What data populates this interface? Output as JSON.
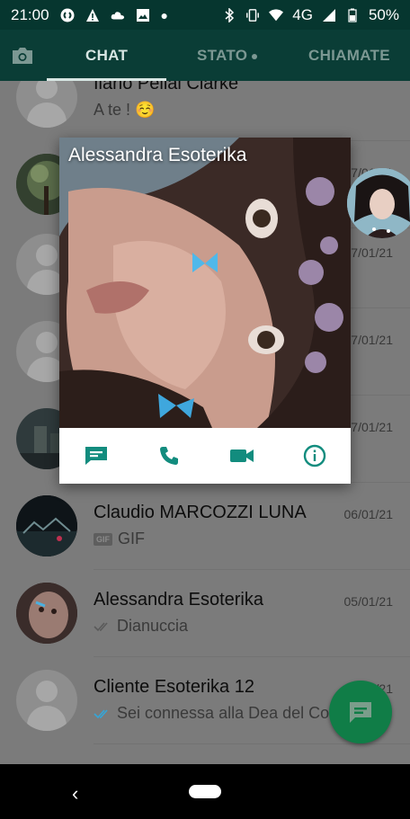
{
  "status_bar": {
    "time": "21:00",
    "network": "4G",
    "battery": "50%"
  },
  "tabs": {
    "chat": "CHAT",
    "stato": "STATO",
    "chiamate": "CHIAMATE"
  },
  "chats": [
    {
      "name": "Ilario Pellai Clarke",
      "message": "A te ! ☺️",
      "date": ""
    },
    {
      "name": "",
      "message": "",
      "date": "07/01/21"
    },
    {
      "name": "",
      "message": "",
      "date": "07/01/21"
    },
    {
      "name": "",
      "message": "",
      "date": "07/01/21"
    },
    {
      "name": "",
      "message": "",
      "date": "07/01/21"
    },
    {
      "name": "Claudio MARCOZZI LUNA",
      "message": "GIF",
      "gif_badge": "GIF",
      "date": "06/01/21"
    },
    {
      "name": "Alessandra Esoterika",
      "message": "Dianuccia",
      "date": "05/01/21"
    },
    {
      "name": "Cliente Esoterika 12",
      "message": "Sei connessa alla Dea del Co",
      "date": "0?/01/21"
    }
  ],
  "popup": {
    "title": "Alessandra Esoterika",
    "actions": [
      "message-icon",
      "phone-icon",
      "video-icon",
      "info-icon"
    ]
  },
  "colors": {
    "header": "#0a3d36",
    "accent_green": "#107d47",
    "popup_icon_teal": "#128c7e",
    "read_tick_blue": "#34a6d8"
  }
}
